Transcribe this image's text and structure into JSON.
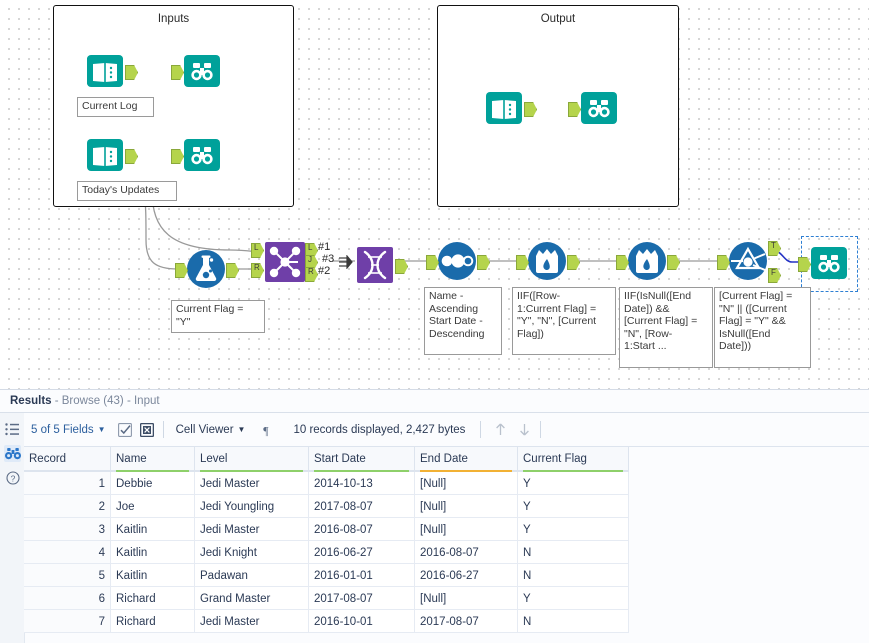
{
  "canvas": {
    "containers": [
      {
        "id": "inputs",
        "title": "Inputs"
      },
      {
        "id": "output",
        "title": "Output"
      }
    ],
    "annotations": {
      "current_log": "Current Log",
      "todays_updates": "Today's Updates",
      "current_flag_filter": "Current Flag =\n\"Y\"",
      "sort": "Name -\nAscending\nStart Date -\nDescending",
      "multirow_1": "IIF([Row-\n1:Current Flag] =\n\"Y\", \"N\", [Current\nFlag])",
      "multirow_2": "IIF(IsNull([End\nDate]) &&\n[Current Flag] =\n\"N\", [Row-\n1:Start ...",
      "filter_expr": "[Current Flag] =\n\"N\" || ([Current\nFlag] = \"Y\" &&\nIsNull([End\nDate]))"
    },
    "join_output_labels": [
      "#1",
      "#3",
      "#2"
    ],
    "port_labels": {
      "left": "L",
      "join": "J",
      "right": "R",
      "true": "T",
      "false": "F"
    },
    "tool_names": {
      "input": "input-data-tool",
      "browse": "browse-tool",
      "filter_flask": "filter-tool",
      "join_multiple": "join-multiple-tool",
      "union": "union-tool",
      "sort": "sort-tool",
      "multi_row": "multi-row-formula-tool",
      "filter": "filter-tool"
    },
    "colors": {
      "teal": "#00a19a",
      "purple": "#6f3fa8",
      "blue": "#1a6bab",
      "port_green": "#b5d44c",
      "selection_blue": "#2d7fd3",
      "wire_blue": "#2432c4"
    }
  },
  "results": {
    "title_bold": "Results",
    "title_rest": " - Browse (43) - Input",
    "rail": [
      {
        "name": "list-icon",
        "label": "list"
      },
      {
        "name": "binoculars-icon",
        "label": "browse"
      },
      {
        "name": "help-icon",
        "label": "help"
      }
    ],
    "toolbar": {
      "fields_label": "5 of 5 Fields",
      "select_all_icon": "checkbox-check-icon",
      "deselect_all_icon": "checkbox-cross-icon",
      "viewer_label": "Cell Viewer",
      "pilcrow_icon": "pilcrow-icon",
      "record_status": "10 records displayed, 2,427 bytes",
      "up_icon": "arrow-up-icon",
      "down_icon": "arrow-down-icon"
    },
    "table": {
      "columns": [
        {
          "label": "Record",
          "underline": ""
        },
        {
          "label": "Name",
          "underline": "#8ed06a"
        },
        {
          "label": "Level",
          "underline": "#8ed06a"
        },
        {
          "label": "Start Date",
          "underline": "#8ed06a"
        },
        {
          "label": "End Date",
          "underline": "#f2b134"
        },
        {
          "label": "Current Flag",
          "underline": "#8ed06a"
        }
      ],
      "rows": [
        [
          "1",
          "Debbie",
          "Jedi Master",
          "2014-10-13",
          "[Null]",
          "Y"
        ],
        [
          "2",
          "Joe",
          "Jedi Youngling",
          "2017-08-07",
          "[Null]",
          "Y"
        ],
        [
          "3",
          "Kaitlin",
          "Jedi Master",
          "2016-08-07",
          "[Null]",
          "Y"
        ],
        [
          "4",
          "Kaitlin",
          "Jedi Knight",
          "2016-06-27",
          "2016-08-07",
          "N"
        ],
        [
          "5",
          "Kaitlin",
          "Padawan",
          "2016-01-01",
          "2016-06-27",
          "N"
        ],
        [
          "6",
          "Richard",
          "Grand Master",
          "2017-08-07",
          "[Null]",
          "Y"
        ],
        [
          "7",
          "Richard",
          "Jedi Master",
          "2016-10-01",
          "2017-08-07",
          "N"
        ]
      ]
    }
  }
}
